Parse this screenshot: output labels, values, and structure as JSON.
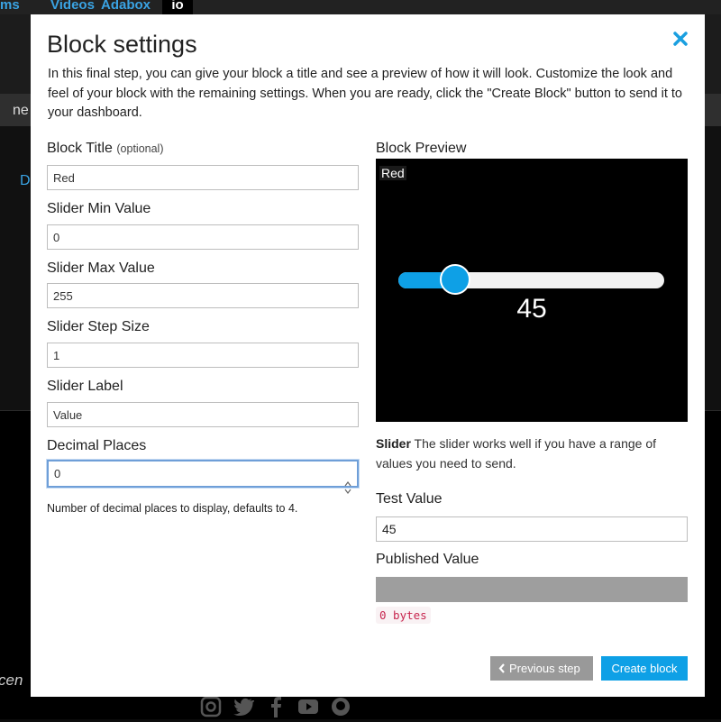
{
  "background": {
    "nav": [
      "ms",
      "Videos",
      "Adabox",
      "io"
    ],
    "band_text": "ne",
    "body_letter": "D",
    "footer_text": "cen",
    "social_icons": [
      "instagram-icon",
      "twitter-icon",
      "facebook-icon",
      "youtube-icon",
      "github-icon"
    ]
  },
  "modal": {
    "title": "Block settings",
    "close_icon": "close-icon",
    "description": "In this final step, you can give your block a title and see a preview of how it will look. Customize the look and feel of your block with the remaining settings. When you are ready, click the \"Create Block\" button to send it to your dashboard.",
    "fields": {
      "block_title": {
        "label": "Block Title",
        "optional": "(optional)",
        "value": "Red"
      },
      "min": {
        "label": "Slider Min Value",
        "value": "0"
      },
      "max": {
        "label": "Slider Max Value",
        "value": "255"
      },
      "step": {
        "label": "Slider Step Size",
        "value": "1"
      },
      "slider_label": {
        "label": "Slider Label",
        "value": "Value"
      },
      "decimal": {
        "label": "Decimal Places",
        "value": "0",
        "help": "Number of decimal places to display, defaults to 4."
      }
    },
    "preview": {
      "label": "Block Preview",
      "block_title": "Red",
      "value": "45",
      "min": 0,
      "max": 255,
      "level": 45,
      "colors": {
        "fill": "#0ea0e6",
        "track": "#f2f2f2",
        "background": "#000000"
      }
    },
    "slider_desc": {
      "name": "Slider",
      "text": "The slider works well if you have a range of values you need to send."
    },
    "test_value": {
      "label": "Test Value",
      "value": "45"
    },
    "published": {
      "label": "Published Value",
      "bytes": "0 bytes"
    },
    "buttons": {
      "previous": "Previous step",
      "create": "Create block"
    }
  }
}
